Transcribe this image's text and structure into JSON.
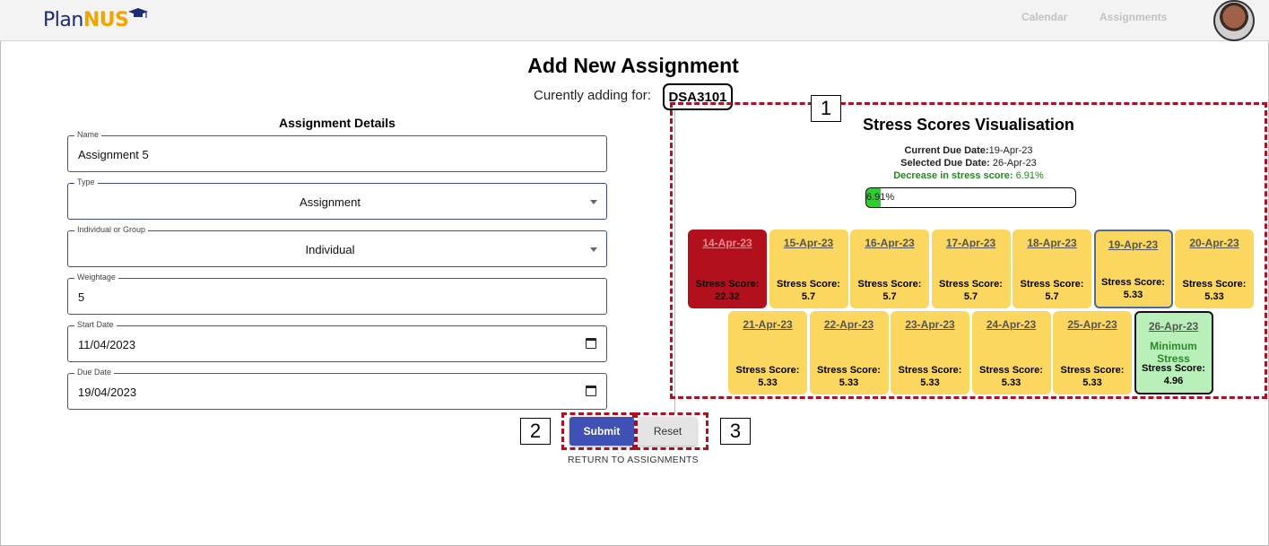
{
  "header": {
    "logo_plan": "Plan",
    "logo_nus": "NUS",
    "nav": [
      "Calendar",
      "Assignments"
    ]
  },
  "page": {
    "title": "Add New Assignment",
    "adding_for_label": "Curently adding for:",
    "course_code": "DSA3101"
  },
  "form": {
    "section_title": "Assignment Details",
    "name": {
      "label": "Name",
      "value": "Assignment 5"
    },
    "type": {
      "label": "Type",
      "value": "Assignment"
    },
    "group": {
      "label": "Individual or Group",
      "value": "Individual"
    },
    "weightage": {
      "label": "Weightage",
      "value": "5"
    },
    "start_date": {
      "label": "Start Date",
      "value": "11/04/2023"
    },
    "due_date": {
      "label": "Due Date",
      "value": "19/04/2023"
    },
    "submit_label": "Submit",
    "reset_label": "Reset",
    "return_label": "RETURN TO ASSIGNMENTS"
  },
  "annotations": {
    "box1": "1",
    "box2": "2",
    "box3": "3"
  },
  "viz": {
    "title": "Stress Scores Visualisation",
    "current_due_label": "Current Due Date:",
    "current_due_value": "19-Apr-23",
    "selected_due_label": "Selected Due Date:",
    "selected_due_value": " 26-Apr-23",
    "decrease_label": "Decrease in stress score:",
    "decrease_value": " 6.91%",
    "progress_text": "6.91%",
    "progress_fraction": 0.0691,
    "score_label": "Stress Score:",
    "days_row1": [
      {
        "date": "14-Apr-23",
        "score": "22.32",
        "state": "red"
      },
      {
        "date": "15-Apr-23",
        "score": "5.7",
        "state": "normal"
      },
      {
        "date": "16-Apr-23",
        "score": "5.7",
        "state": "normal"
      },
      {
        "date": "17-Apr-23",
        "score": "5.7",
        "state": "normal"
      },
      {
        "date": "18-Apr-23",
        "score": "5.7",
        "state": "normal"
      },
      {
        "date": "19-Apr-23",
        "score": "5.33",
        "state": "selected"
      },
      {
        "date": "20-Apr-23",
        "score": "5.33",
        "state": "normal"
      }
    ],
    "days_row2": [
      {
        "date": "21-Apr-23",
        "score": "5.33",
        "state": "normal"
      },
      {
        "date": "22-Apr-23",
        "score": "5.33",
        "state": "normal"
      },
      {
        "date": "23-Apr-23",
        "score": "5.33",
        "state": "normal"
      },
      {
        "date": "24-Apr-23",
        "score": "5.33",
        "state": "normal"
      },
      {
        "date": "25-Apr-23",
        "score": "5.33",
        "state": "normal"
      },
      {
        "date": "26-Apr-23",
        "score": "4.96",
        "state": "minimum",
        "note": "Minimum Stress"
      }
    ],
    "colors": {
      "high": "#b3101e",
      "normal": "#fbd75f",
      "minimum": "#b9f0b9",
      "progress": "#2ecc2e"
    }
  }
}
